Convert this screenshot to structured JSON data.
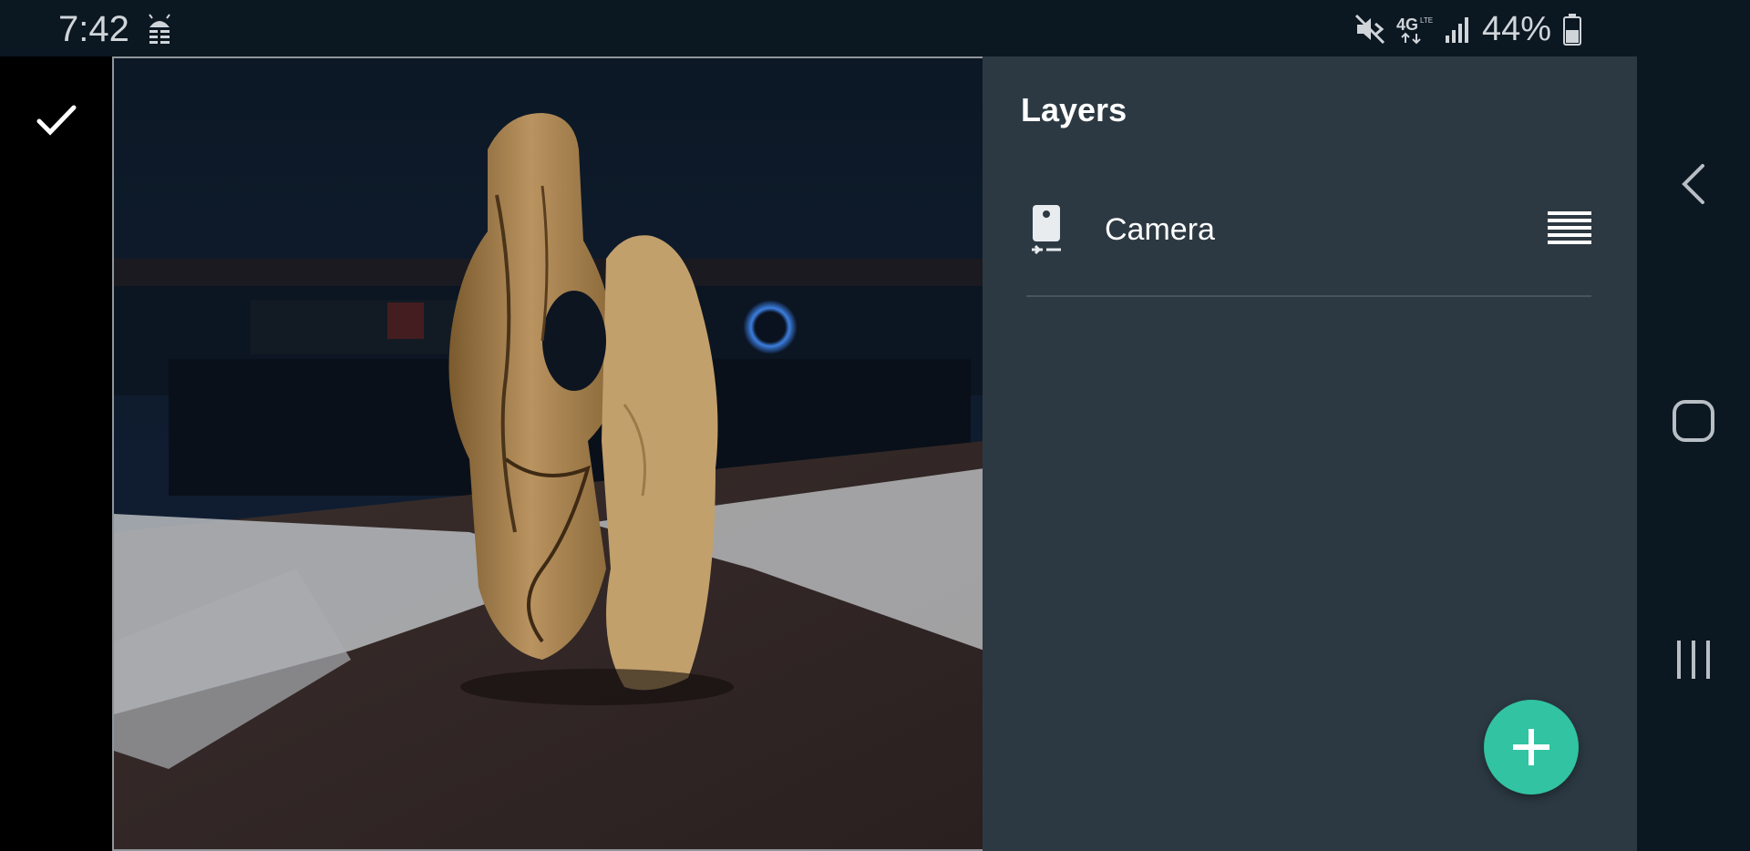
{
  "status_bar": {
    "time": "7:42",
    "notification_icon": "android-debug-icon",
    "icons": [
      "mute-icon",
      "4g-lte-icon",
      "signal-icon"
    ],
    "battery_text": "44%",
    "battery_icon": "battery-icon"
  },
  "toolbar": {
    "done_icon": "checkmark-icon"
  },
  "preview": {
    "description_icon": "camera-preview"
  },
  "layers_panel": {
    "title": "Layers",
    "layers": [
      {
        "label": "Camera",
        "icon": "phone-camera-icon",
        "handle_icon": "drag-handle-icon"
      }
    ],
    "add_button_icon": "plus-icon"
  },
  "nav_bar": {
    "buttons": [
      "back-icon",
      "home-icon",
      "recents-icon"
    ]
  },
  "colors": {
    "panel_bg": "#2c3942",
    "fab": "#31c3a2",
    "status_bg": "#0b1721"
  }
}
